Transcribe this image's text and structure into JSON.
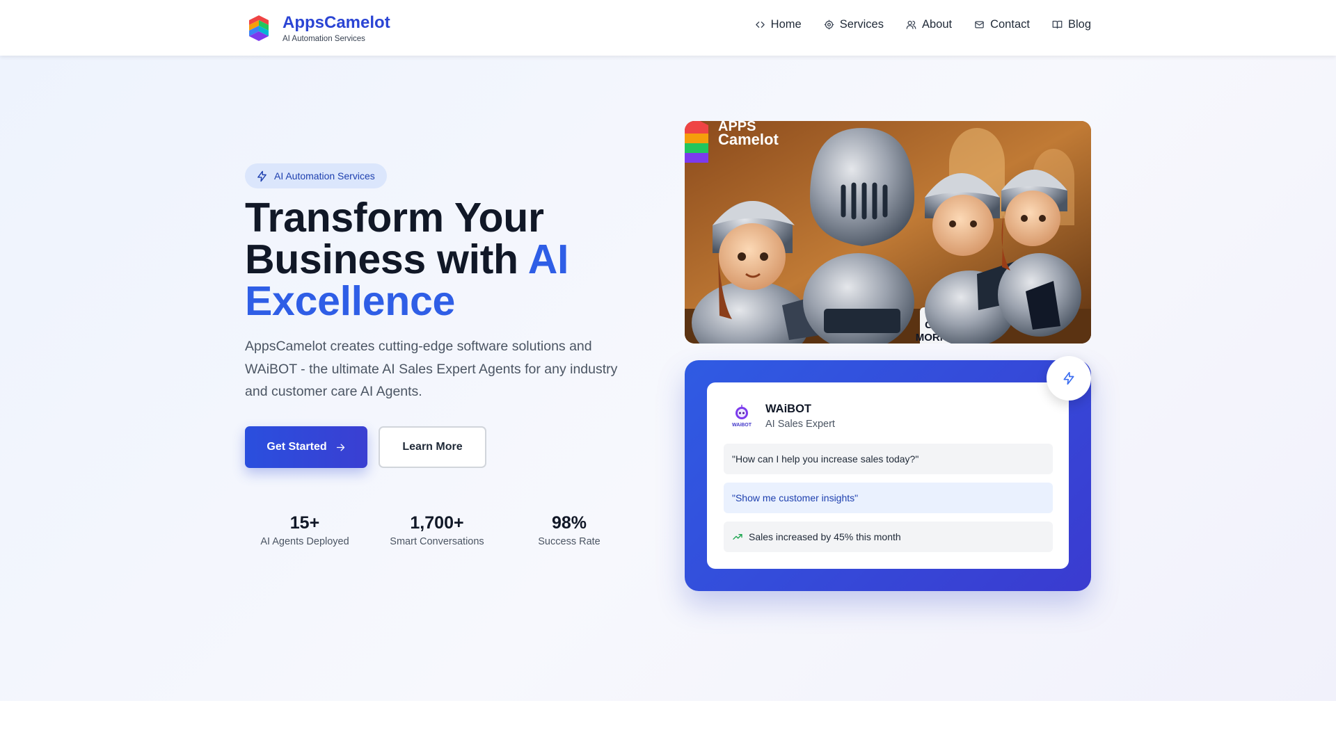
{
  "header": {
    "brand_name": "AppsCamelot",
    "brand_tagline": "AI Automation Services",
    "nav": [
      {
        "label": "Home",
        "icon": "code-icon"
      },
      {
        "label": "Services",
        "icon": "gear-icon"
      },
      {
        "label": "About",
        "icon": "users-icon"
      },
      {
        "label": "Contact",
        "icon": "mail-icon"
      },
      {
        "label": "Blog",
        "icon": "book-icon"
      }
    ]
  },
  "hero": {
    "badge": "AI Automation Services",
    "headline_part1": "Transform Your Business with ",
    "headline_accent": "AI Excellence",
    "lead": "AppsCamelot creates cutting-edge software solutions and WAiBOT - the ultimate AI Sales Expert Agents for any industry and customer care AI Agents.",
    "cta_primary": "Get Started",
    "cta_secondary": "Learn More",
    "stats": [
      {
        "value": "15+",
        "label": "AI Agents Deployed"
      },
      {
        "value": "1,700+",
        "label": "Smart Conversations"
      },
      {
        "value": "98%",
        "label": "Success Rate"
      }
    ]
  },
  "hero_image": {
    "logo_line1": "APPS",
    "logo_line2": "Camelot",
    "mug_line1": "GOOD",
    "mug_line2": "MORNING"
  },
  "bot_card": {
    "avatar_label": "WAiBOT",
    "name": "WAiBOT",
    "role": "AI Sales Expert",
    "messages": [
      "\"How can I help you increase sales today?\"",
      "\"Show me customer insights\"",
      "Sales increased by 45% this month"
    ]
  },
  "colors": {
    "brand": "#2b45d4",
    "accent": "#2f5ee6",
    "card_gradient_start": "#2f5be3",
    "card_gradient_end": "#3a3bd0",
    "positive": "#16a34a"
  }
}
